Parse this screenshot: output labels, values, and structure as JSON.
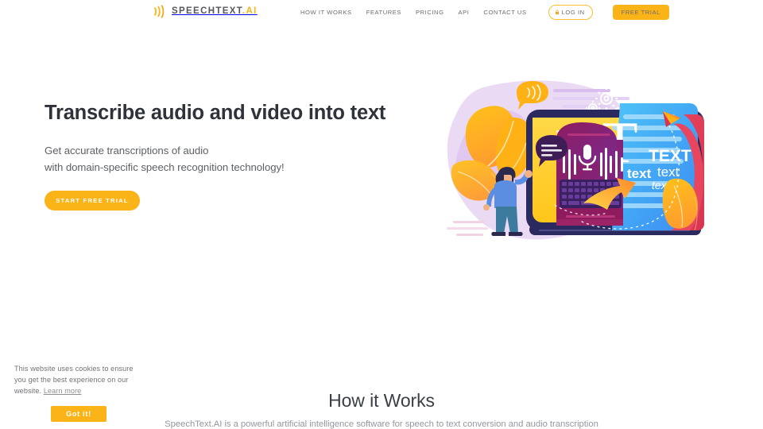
{
  "header": {
    "logo": {
      "mark_icon": "soundwave-icon",
      "name": "SPEECHTEXT",
      "suffix": ".AI"
    },
    "nav_items": [
      {
        "label": "HOW IT WORKS"
      },
      {
        "label": "FEATURES"
      },
      {
        "label": "PRICING"
      },
      {
        "label": "API"
      },
      {
        "label": "CONTACT US"
      }
    ],
    "login_button": {
      "label": "LOG IN",
      "icon": "lock-icon"
    },
    "free_trial_button": {
      "label": "FREE TRIAL"
    }
  },
  "hero": {
    "title": "Transcribe audio and video into text",
    "subtitle_line1": "Get accurate transcriptions of audio",
    "subtitle_line2": "with domain-specific speech recognition technology!",
    "cta_label": "START FREE TRIAL",
    "illustration": {
      "name": "speech-to-text-illustration",
      "text_big": "T",
      "text_caps": "TEXT",
      "text_bold": "text",
      "text_regular": "text",
      "text_italic": "text",
      "icons": [
        "microphone-icon",
        "speech-bubble-icon",
        "gear-icon",
        "paper-plane-icon",
        "arrow-icon",
        "keyboard-icon",
        "person-figure"
      ]
    }
  },
  "how_it_works": {
    "title": "How it Works",
    "subtitle": "SpeechText.AI is a powerful artificial intelligence software for speech to text conversion and audio transcription"
  },
  "cookie_banner": {
    "text": "This website uses cookies to ensure you get the best experience on our website.",
    "link_label": "Learn more",
    "accept_label": "Got it!"
  },
  "colors": {
    "brand_amber": "#fbb417",
    "brand_amber_light": "#fbbe2e",
    "heading_dark": "#2e3239",
    "body_gray": "#5d6166",
    "nav_gray": "#6d6d6d"
  }
}
